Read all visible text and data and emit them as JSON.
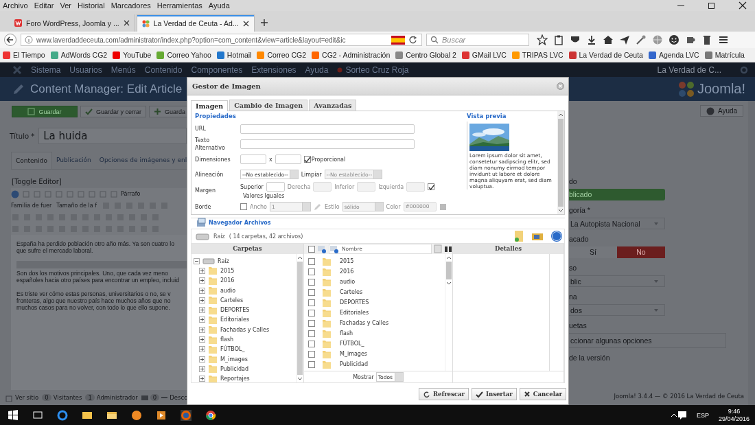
{
  "menu_bar": [
    "Archivo",
    "Editar",
    "Ver",
    "Historial",
    "Marcadores",
    "Herramientas",
    "Ayuda"
  ],
  "tabs": [
    {
      "title": "Foro WordPress, Joomla y ...",
      "selected": false
    },
    {
      "title": "La Verdad de Ceuta - Ad...",
      "selected": true
    }
  ],
  "url": "www.laverdaddeceuta.com/administrator/index.php?option=com_content&view=article&layout=edit&ic",
  "search_placeholder": "Buscar",
  "bookmarks": [
    "El Tiempo",
    "AdWords CG2",
    "YouTube",
    "Correo Yahoo",
    "Hotmail",
    "Correo CG2",
    "CG2 - Administración",
    "Centro Global 2",
    "GMail LVC",
    "TRIPAS LVC",
    "La Verdad de Ceuta",
    "Agenda LVC",
    "Matrícula"
  ],
  "admin": {
    "nav": [
      "Sistema",
      "Usuarios",
      "Menús",
      "Contenido",
      "Componentes",
      "Extensiones",
      "Ayuda",
      "Sorteo Cruz Roja"
    ],
    "site_name": "La Verdad de C...",
    "page_title": "Content Manager: Edit Article",
    "logo_text": "Joomla!",
    "toolbar": [
      {
        "label": "Guardar",
        "kind": "primary"
      },
      {
        "label": "Guardar y cerrar",
        "kind": "check"
      },
      {
        "label": "Guarda",
        "kind": "plus"
      }
    ],
    "help": "Ayuda",
    "title_label": "Título *",
    "title_value": "La huida",
    "tabs": [
      {
        "label": "Contenido",
        "selected": true
      },
      {
        "label": "Publicación",
        "selected": false
      },
      {
        "label": "Opciones de imágenes y enl",
        "selected": false
      }
    ],
    "toggle_editor": "[Toggle Editor]",
    "editor_selects": [
      "Párrafo",
      "Familia de fuer",
      "Tamaño de la f"
    ],
    "paragraphs": [
      [
        "España ha perdido población otro año más. Ya son cuatro lo",
        "que sufre el mercado laboral."
      ],
      [
        "Son dos los motivos principales. Uno, que cada vez meno",
        "españoles hacia otro países para encontrar un empleo, incluid"
      ],
      [
        "Es triste ver cómo estas personas, universitarios o no, se v",
        "fronteras, algo que nuestro país hace muchos años que no",
        "muchos casos para no volver, con todo lo que ello supone."
      ]
    ],
    "status": [
      {
        "kind": "link",
        "text": "Ver sitio"
      },
      {
        "kind": "count",
        "count": "0",
        "text": "Visitantes"
      },
      {
        "kind": "count",
        "count": "1",
        "text": "Administrador"
      },
      {
        "kind": "logout",
        "count": "0",
        "text": "Desco"
      }
    ],
    "footer": "Joomla! 3.4.4 — © 2016 La Verdad de Ceuta",
    "side": [
      {
        "kind": "status",
        "label": "do",
        "value": "blicado"
      },
      {
        "kind": "select",
        "label": "goría *",
        "value": "La Autopista Nacional"
      },
      {
        "kind": "toggle",
        "label": "acado",
        "options": [
          {
            "label": "Sí",
            "selected": false
          },
          {
            "label": "No",
            "selected": true
          }
        ]
      },
      {
        "kind": "select",
        "label": "so",
        "value": "blic"
      },
      {
        "kind": "select",
        "label": "na",
        "value": "dos"
      },
      {
        "kind": "tags",
        "label": "uetas",
        "placeholder": "ccionar algunas opciones"
      },
      {
        "kind": "text",
        "label": "de la versión"
      }
    ]
  },
  "dialog": {
    "title": "Gestor de Imagen",
    "tabs": [
      {
        "label": "Imagen",
        "selected": true
      },
      {
        "label": "Cambio de Imagen",
        "selected": false
      },
      {
        "label": "Avanzadas",
        "selected": false
      }
    ],
    "properties_heading": "Propiedades",
    "url_label": "URL",
    "alt_label": "Texto Alternativo",
    "dimensions_label": "Dimensiones",
    "dimensions_x": "x",
    "proportional": {
      "label": "Proporcional",
      "checked": true
    },
    "align_label": "Alineación",
    "align_value": "--No establecido--",
    "clear_label": "Limpiar",
    "clear_value": "--No establecido--",
    "margin_label": "Margen",
    "margins": [
      {
        "label": "Superior",
        "disabled": false
      },
      {
        "label": "Derecha",
        "disabled": true
      },
      {
        "label": "Inferior",
        "disabled": true
      },
      {
        "label": "Izquierda",
        "disabled": true
      }
    ],
    "equal_margins": {
      "label": "Valores Iguales",
      "checked": true
    },
    "border_label": "Borde",
    "border_checked": false,
    "border_width": {
      "label": "Ancho",
      "value": "1"
    },
    "border_style": {
      "label": "Estilo",
      "value": "sólido"
    },
    "border_color": {
      "label": "Color",
      "value": "#000000"
    },
    "preview_heading": "Vista previa",
    "preview_text": "Lorem ipsum dolor sit amet, consetetur sadipscing elitr, sed diam nonumy eirmod tempor invidunt ut labore et dolore magna aliquyam erat, sed diam voluptua.",
    "browser": {
      "heading": "Navegador Archivos",
      "root": "Raíz",
      "summary": "( 14 carpetas, 42 archivos)",
      "folders_header": "Carpetas",
      "name_header": "Nombre",
      "details_header": "Detalles",
      "tree_root": "Raíz",
      "folders": [
        "2015",
        "2016",
        "audio",
        "Carteles",
        "DEPORTES",
        "Editoriales",
        "Fachadas y Calles",
        "flash",
        "FÚTBOL_",
        "M_images",
        "Publicidad",
        "Reportajes"
      ],
      "select_all_checked": false,
      "files": [
        {
          "name": "2015",
          "checked": false
        },
        {
          "name": "2016",
          "checked": false
        },
        {
          "name": "audio",
          "checked": false
        },
        {
          "name": "Carteles",
          "checked": false
        },
        {
          "name": "DEPORTES",
          "checked": false
        },
        {
          "name": "Editoriales",
          "checked": false
        },
        {
          "name": "Fachadas y Calles",
          "checked": false
        },
        {
          "name": "flash",
          "checked": false
        },
        {
          "name": "FÚTBOL_",
          "checked": false
        },
        {
          "name": "M_images",
          "checked": false
        },
        {
          "name": "Publicidad",
          "checked": false
        }
      ],
      "show_label": "Mostrar",
      "show_value": "Todos"
    },
    "buttons": [
      {
        "label": "Refrescar",
        "kind": "refresh"
      },
      {
        "label": "Insertar",
        "kind": "check"
      },
      {
        "label": "Cancelar",
        "kind": "cancel"
      }
    ]
  },
  "taskbar": {
    "language": "ESP",
    "time": "9:46",
    "date": "29/04/2016"
  }
}
